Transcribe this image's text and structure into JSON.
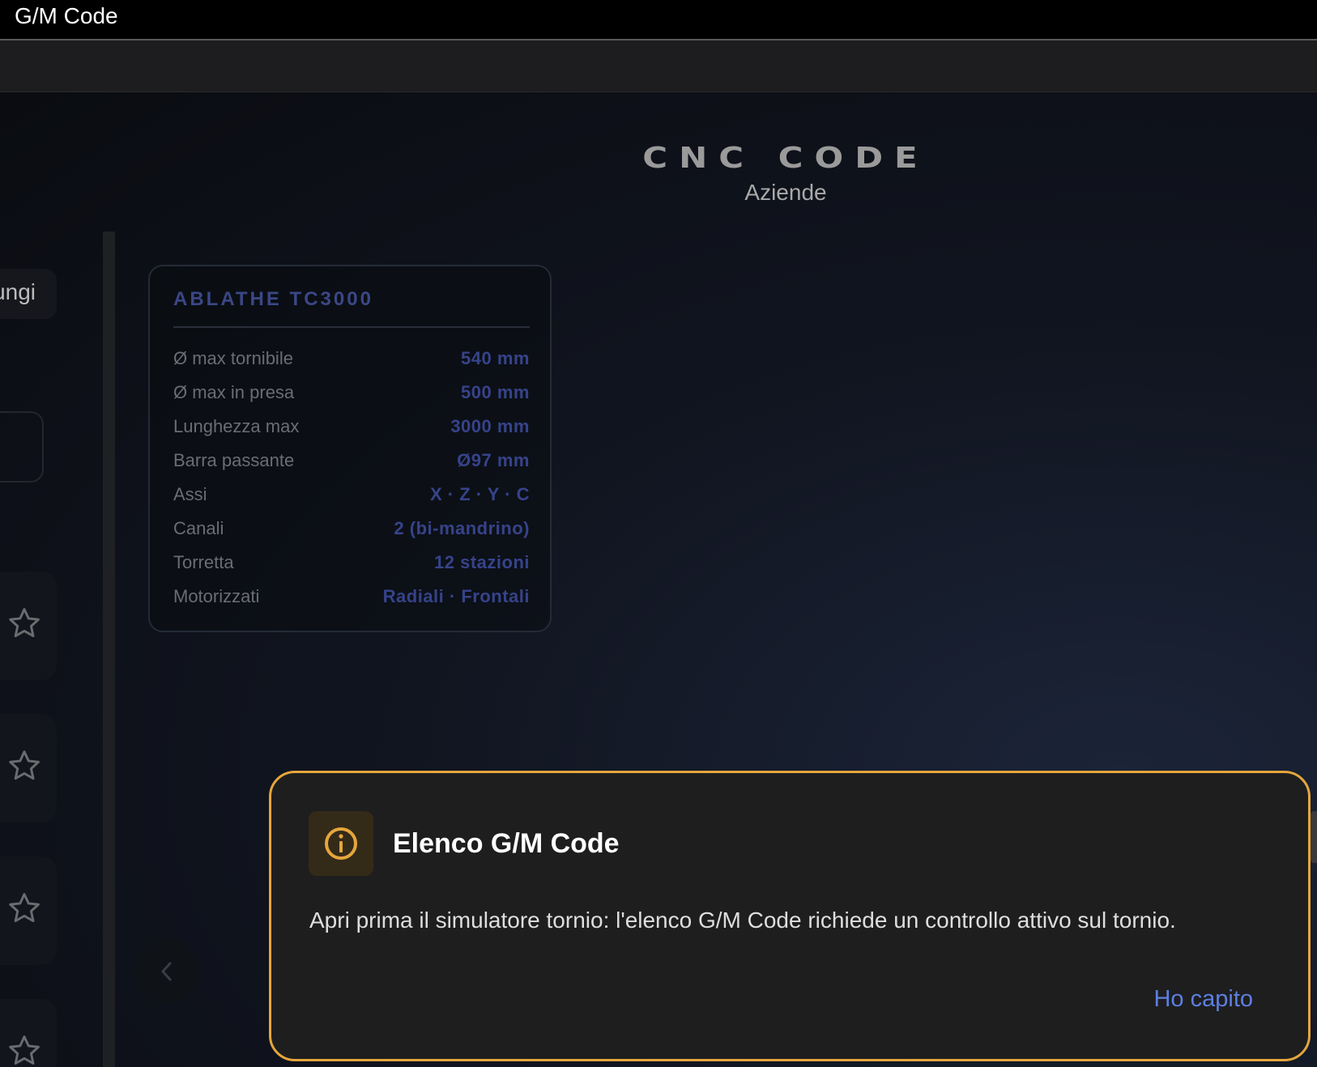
{
  "window": {
    "title": "G/M Code"
  },
  "brand": {
    "logo": "CNC CODE",
    "subtitle": "Aziende"
  },
  "sidebar": {
    "add_label": "ungi",
    "favorites_count": 4
  },
  "machine": {
    "name": "ABLATHE TC3000",
    "specs": [
      {
        "label": "Ø max tornibile",
        "value": "540 mm"
      },
      {
        "label": "Ø max in presa",
        "value": "500 mm"
      },
      {
        "label": "Lunghezza max",
        "value": "3000 mm"
      },
      {
        "label": "Barra passante",
        "value": "Ø97 mm"
      },
      {
        "label": "Assi",
        "value": "X · Z · Y · C"
      },
      {
        "label": "Canali",
        "value": "2 (bi-mandrino)"
      },
      {
        "label": "Torretta",
        "value": "12 stazioni"
      },
      {
        "label": "Motorizzati",
        "value": "Radiali · Frontali"
      }
    ]
  },
  "dialog": {
    "title": "Elenco G/M Code",
    "message": "Apri prima il simulatore tornio: l'elenco G/M Code richiede un controllo attivo sul tornio.",
    "confirm_label": "Ho capito",
    "icon": "info-icon"
  },
  "colors": {
    "accent_warning": "#e5a63c",
    "link_blue": "#5d7fe0",
    "spec_value": "#36438a"
  }
}
